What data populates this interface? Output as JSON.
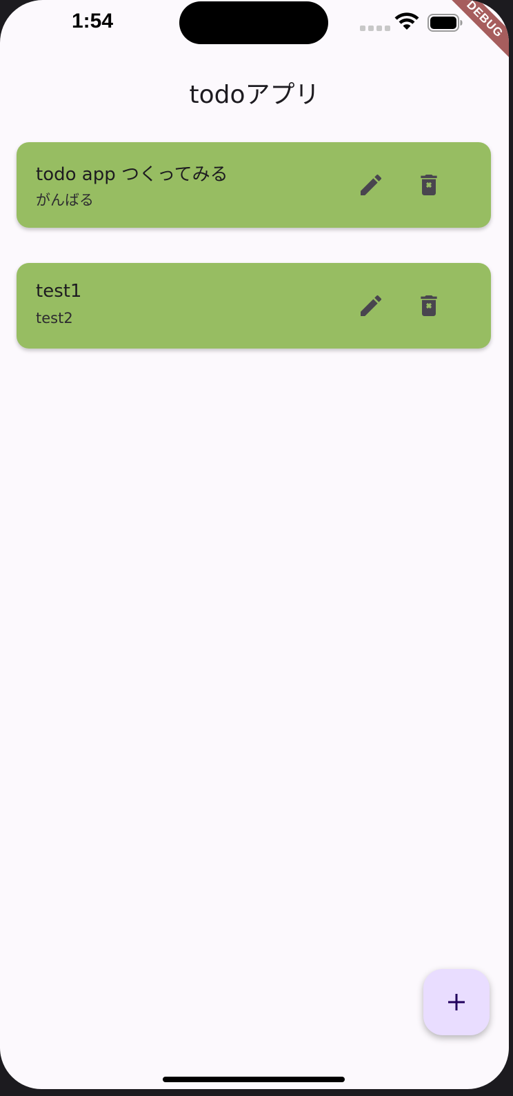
{
  "status_bar": {
    "time": "1:54",
    "debug_label": "DEBUG"
  },
  "app_bar": {
    "title": "todoアプリ"
  },
  "todos": [
    {
      "title": "todo app つくってみる",
      "subtitle": "がんばる",
      "edit_icon": "pencil-icon",
      "delete_icon": "trash-x-icon"
    },
    {
      "title": "test1",
      "subtitle": "test2",
      "edit_icon": "pencil-icon",
      "delete_icon": "trash-x-icon"
    }
  ],
  "fab": {
    "icon": "plus-icon"
  },
  "colors": {
    "card_background": "#97bd62",
    "page_background": "#fcf9fd",
    "fab_background": "#e9ddff",
    "icon_color": "#49454f",
    "debug_banner": "#a65d5d"
  }
}
